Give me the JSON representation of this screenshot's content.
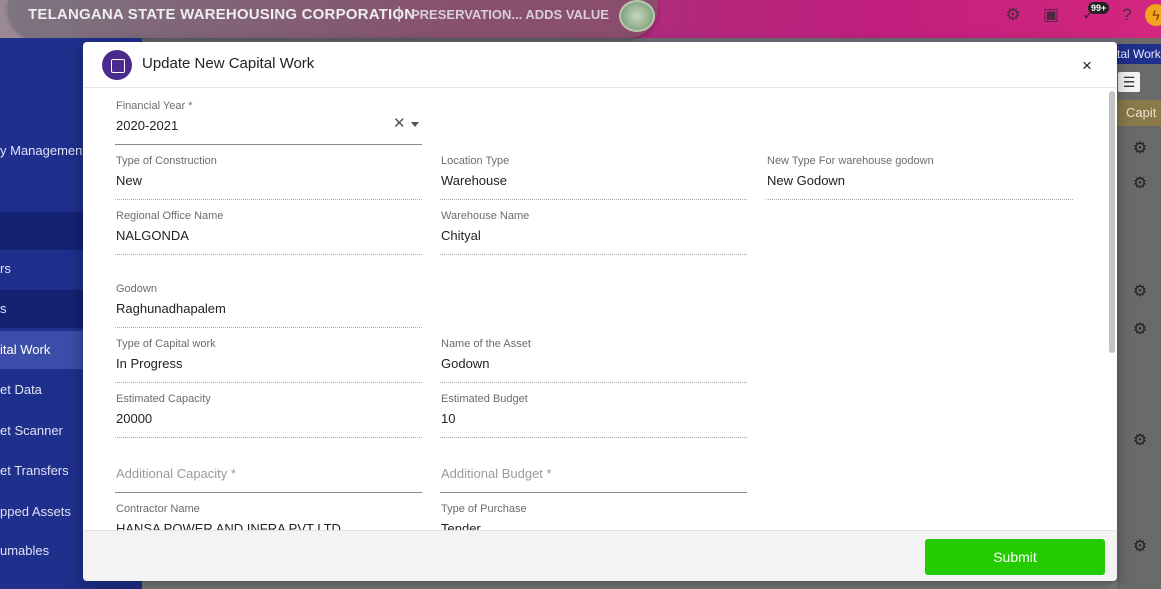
{
  "app": {
    "title": "TELANGANA STATE WAREHOUSING CORPORATION",
    "separator": "|",
    "tagline": "PRESERVATION... ADDS VALUE",
    "notifications_badge": "99+",
    "icons": [
      "gear-icon",
      "store-icon",
      "check-badge-icon",
      "help-icon",
      "bolt-icon"
    ]
  },
  "sidebar": {
    "items": [
      {
        "label": "y Management"
      },
      {
        "label": ""
      },
      {
        "label": "rs"
      },
      {
        "label": "s"
      },
      {
        "label": "ital Work"
      },
      {
        "label": "et Data"
      },
      {
        "label": "et Scanner"
      },
      {
        "label": "et Transfers"
      },
      {
        "label": "pped Assets"
      },
      {
        "label": "umables"
      }
    ]
  },
  "background": {
    "tab_label": "tal Work",
    "column_header": "Capit"
  },
  "modal": {
    "title": "Update New Capital Work",
    "close_glyph": "×",
    "fields": {
      "financial_year": {
        "label": "Financial Year *",
        "value": "2020-2021"
      },
      "type_of_construction": {
        "label": "Type of Construction",
        "value": "New"
      },
      "location_type": {
        "label": "Location Type",
        "value": "Warehouse"
      },
      "new_type_godown": {
        "label": "New Type For warehouse godown",
        "value": "New Godown"
      },
      "regional_office": {
        "label": "Regional Office Name",
        "value": "NALGONDA"
      },
      "warehouse_name": {
        "label": "Warehouse Name",
        "value": "Chityal"
      },
      "godown": {
        "label": "Godown",
        "value": "Raghunadhapalem"
      },
      "type_capital_work": {
        "label": "Type of Capital work",
        "value": "In Progress"
      },
      "name_of_asset": {
        "label": "Name of the Asset",
        "value": "Godown"
      },
      "estimated_capacity": {
        "label": "Estimated Capacity",
        "value": "20000"
      },
      "estimated_budget": {
        "label": "Estimated Budget",
        "value": "10"
      },
      "additional_capacity": {
        "placeholder": "Additional Capacity *"
      },
      "additional_budget": {
        "placeholder": "Additional Budget *"
      },
      "contractor_name": {
        "label": "Contractor Name",
        "value": "HANSA POWER AND INFRA PVT LTD"
      },
      "type_of_purchase": {
        "label": "Type of Purchase",
        "value": "Tender"
      }
    },
    "submit_label": "Submit"
  },
  "colors": {
    "sidebar": "#1f2f8c",
    "submit": "#22cc00",
    "header_icon": "#4a2a8c"
  }
}
